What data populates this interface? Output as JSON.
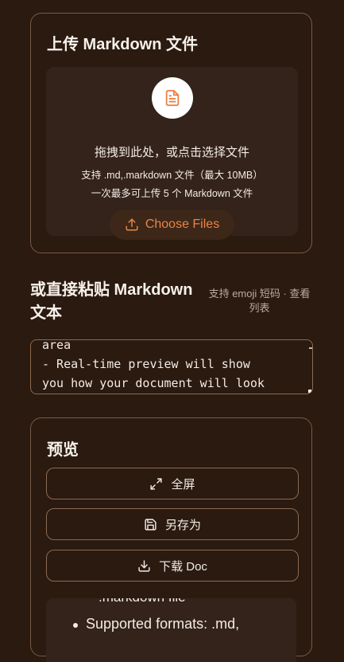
{
  "upload": {
    "title": "上传 Markdown 文件",
    "drop_text": "拖拽到此处，或点击选择文件",
    "supported_text": "支持 .md,.markdown 文件（最大 10MB）",
    "limit_text": "一次最多可上传 5 个 Markdown 文件",
    "choose_button": "Choose Files"
  },
  "paste": {
    "title": "或直接粘贴 Markdown 文本",
    "emoji_hint": "支持 emoji 短码 · 查看列表",
    "textarea_lines": [
      "area",
      "- Real-time preview will show",
      "you how your document will look"
    ]
  },
  "preview": {
    "title": "预览",
    "fullscreen_button": "全屏",
    "save_as_button": "另存为",
    "download_button": "下载 Doc",
    "content_partial": ".markdown file",
    "content_bullet": "Supported formats: .md,"
  },
  "colors": {
    "background": "#2a1a10",
    "accent": "#e8844a",
    "border": "#8c6a52"
  }
}
